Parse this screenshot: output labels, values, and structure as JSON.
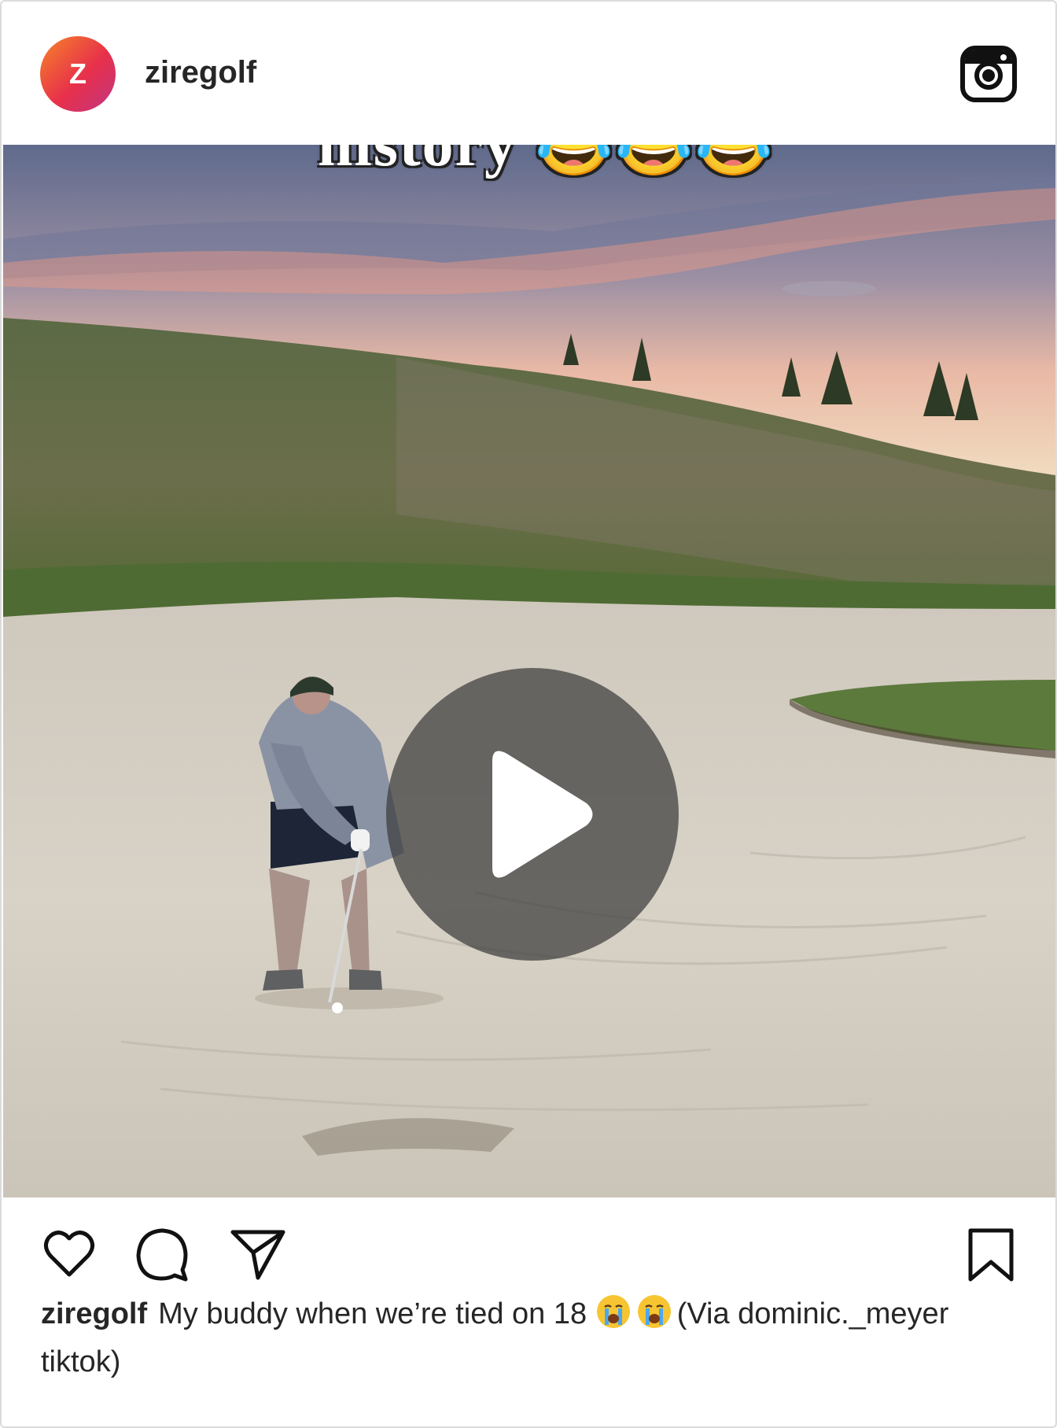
{
  "post": {
    "avatar_letter": "Z",
    "username": "ziregolf",
    "media_overlay_text": "history 😂😂😂",
    "caption_username": "ziregolf",
    "caption_text_before_emoji": "My buddy when we’re tied on 18",
    "caption_emoji": [
      "crying-face-emoji",
      "crying-face-emoji"
    ],
    "caption_text_after_emoji": "(Via dominic._meyer tiktok)"
  },
  "icons": {
    "brand": "instagram-icon",
    "play": "play-icon",
    "like": "heart-icon",
    "comment": "comment-icon",
    "share": "send-icon",
    "save": "bookmark-icon"
  },
  "colors": {
    "avatar_gradient_start": "#f58529",
    "avatar_gradient_end": "#c13584",
    "text": "#262626",
    "border": "#dbdbdb"
  }
}
